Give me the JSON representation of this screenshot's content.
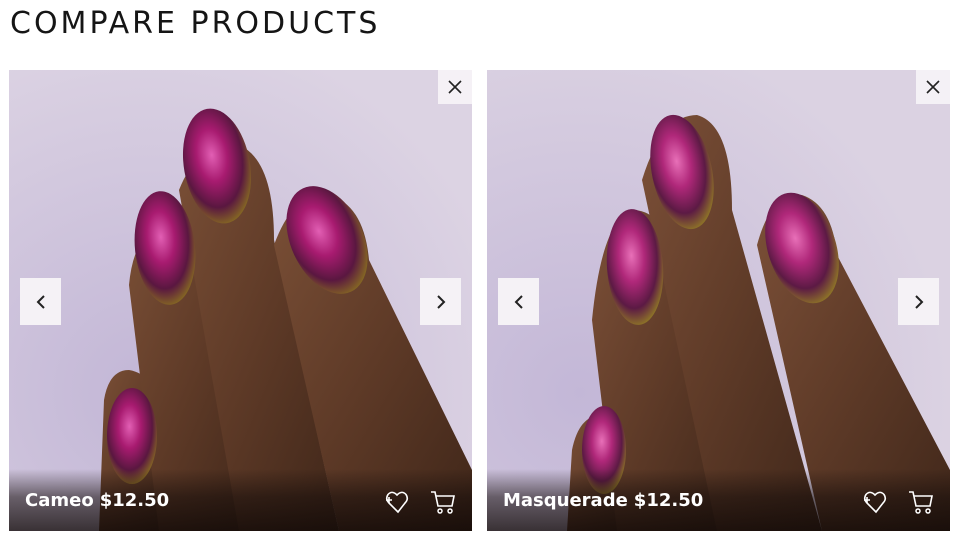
{
  "page": {
    "title": "COMPARE PRODUCTS"
  },
  "products": [
    {
      "name": "Cameo",
      "price": "$12.50",
      "image": "hand-with-purple-gold-chrome-nail-polish"
    },
    {
      "name": "Masquerade",
      "price": "$12.50",
      "image": "hand-with-magenta-gold-chrome-nail-polish"
    }
  ],
  "icons": {
    "remove": "close-icon",
    "prev": "chevron-left-icon",
    "next": "chevron-right-icon",
    "wishlist": "heart-plus-icon",
    "cart": "shopping-cart-icon"
  },
  "colors": {
    "title": "#151515",
    "nav_button_bg": "#f5f2f6",
    "background_lavender": "#d3c8dc",
    "skin": "#6b4330",
    "polish_magenta": "#b0207a",
    "polish_gold": "#9a8a20"
  }
}
